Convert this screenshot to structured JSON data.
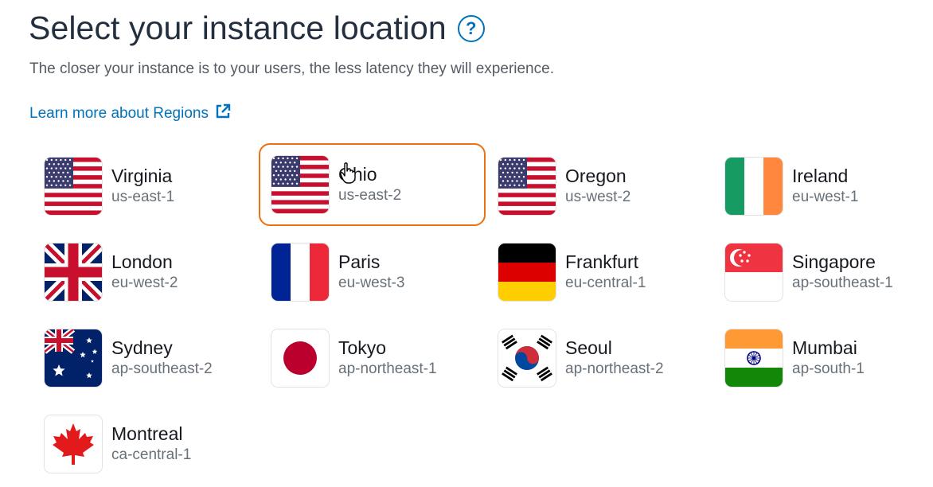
{
  "header": {
    "title": "Select your instance location",
    "help": "?",
    "subtitle": "The closer your instance is to your users, the less latency they will experience.",
    "learn_more": "Learn more about Regions"
  },
  "regions": [
    {
      "name": "Virginia",
      "code": "us-east-1",
      "flag": "us-flag"
    },
    {
      "name": "Ohio",
      "code": "us-east-2",
      "flag": "us-flag",
      "selected": true
    },
    {
      "name": "Oregon",
      "code": "us-west-2",
      "flag": "us-flag"
    },
    {
      "name": "Ireland",
      "code": "eu-west-1",
      "flag": "ie-flag"
    },
    {
      "name": "London",
      "code": "eu-west-2",
      "flag": "uk-flag"
    },
    {
      "name": "Paris",
      "code": "eu-west-3",
      "flag": "fr-flag"
    },
    {
      "name": "Frankfurt",
      "code": "eu-central-1",
      "flag": "de-flag"
    },
    {
      "name": "Singapore",
      "code": "ap-southeast-1",
      "flag": "sg-flag"
    },
    {
      "name": "Sydney",
      "code": "ap-southeast-2",
      "flag": "au-flag"
    },
    {
      "name": "Tokyo",
      "code": "ap-northeast-1",
      "flag": "jp-flag"
    },
    {
      "name": "Seoul",
      "code": "ap-northeast-2",
      "flag": "kr-flag"
    },
    {
      "name": "Mumbai",
      "code": "ap-south-1",
      "flag": "in-flag"
    },
    {
      "name": "Montreal",
      "code": "ca-central-1",
      "flag": "ca-flag"
    }
  ],
  "colors": {
    "link": "#0073bb",
    "selected_border": "#ec7211",
    "title": "#232f3e",
    "muted": "#687078"
  }
}
